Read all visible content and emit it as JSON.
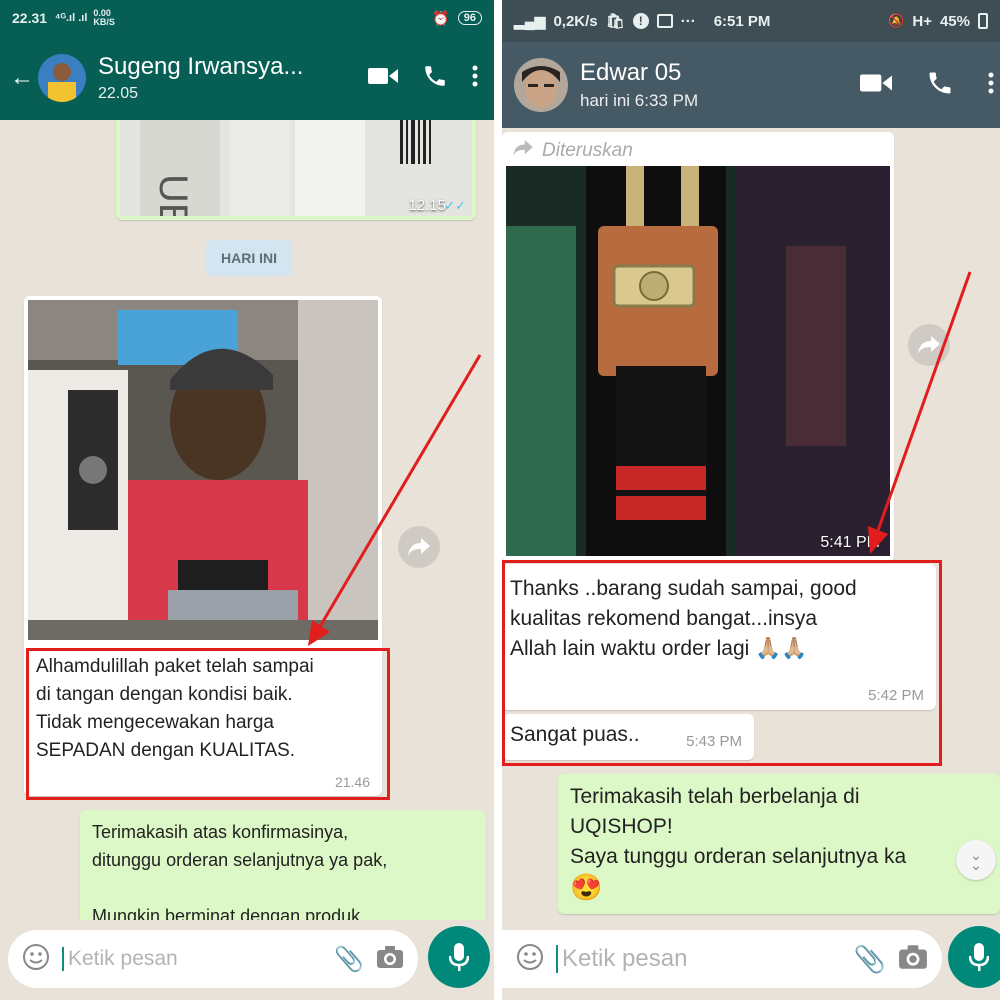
{
  "left": {
    "status": {
      "time": "22.31",
      "signal": "⁴ᴳ.ıl .ıl",
      "speed": "0.00 KB/S",
      "battery": "96"
    },
    "header": {
      "back": "←",
      "name": "Sugeng Irwansya...",
      "subtitle": "22.05"
    },
    "top_image_time": "12.15",
    "date_chip": "HARI INI",
    "message_in": {
      "text": "Alhamdulillah  paket telah sampai\ndi tangan dengan kondisi baik.\nTidak mengecewakan harga\nSEPADAN dengan KUALITAS.",
      "time": "21.46"
    },
    "message_out": {
      "text": "Terimakasih atas konfirmasinya,\nditunggu orderan selanjutnya ya pak,\n\nMungkin berminat dengan produk"
    },
    "input": {
      "placeholder": "Ketik pesan"
    }
  },
  "right": {
    "status": {
      "speed": "0,2K/s",
      "time": "6:51 PM",
      "network": "H+",
      "battery": "45%"
    },
    "header": {
      "name": "Edwar 05",
      "subtitle": "hari ini 6:33 PM"
    },
    "forwarded_label": "Diteruskan",
    "image_time": "5:41 PM",
    "message_in_1": {
      "text": "Thanks ..barang sudah sampai, good\nkualitas rekomend bangat...insya\nAllah lain waktu order lagi",
      "emoji": "🙏🏼🙏🏼",
      "time": "5:42 PM"
    },
    "message_in_2": {
      "text": "Sangat puas..",
      "time": "5:43 PM"
    },
    "message_out": {
      "text": "Terimakasih telah berbelanja di\nUQISHOP!\nSaya tunggu orderan selanjutnya ka",
      "emoji": "😍"
    },
    "input": {
      "placeholder": "Ketik pesan"
    }
  },
  "colors": {
    "header_left": "#075e54",
    "header_right": "#455a64",
    "chat_bg": "#e9e2d9",
    "bubble_out": "#dcf8c6",
    "annotation": "#e11d1d",
    "mic": "#00897b"
  }
}
